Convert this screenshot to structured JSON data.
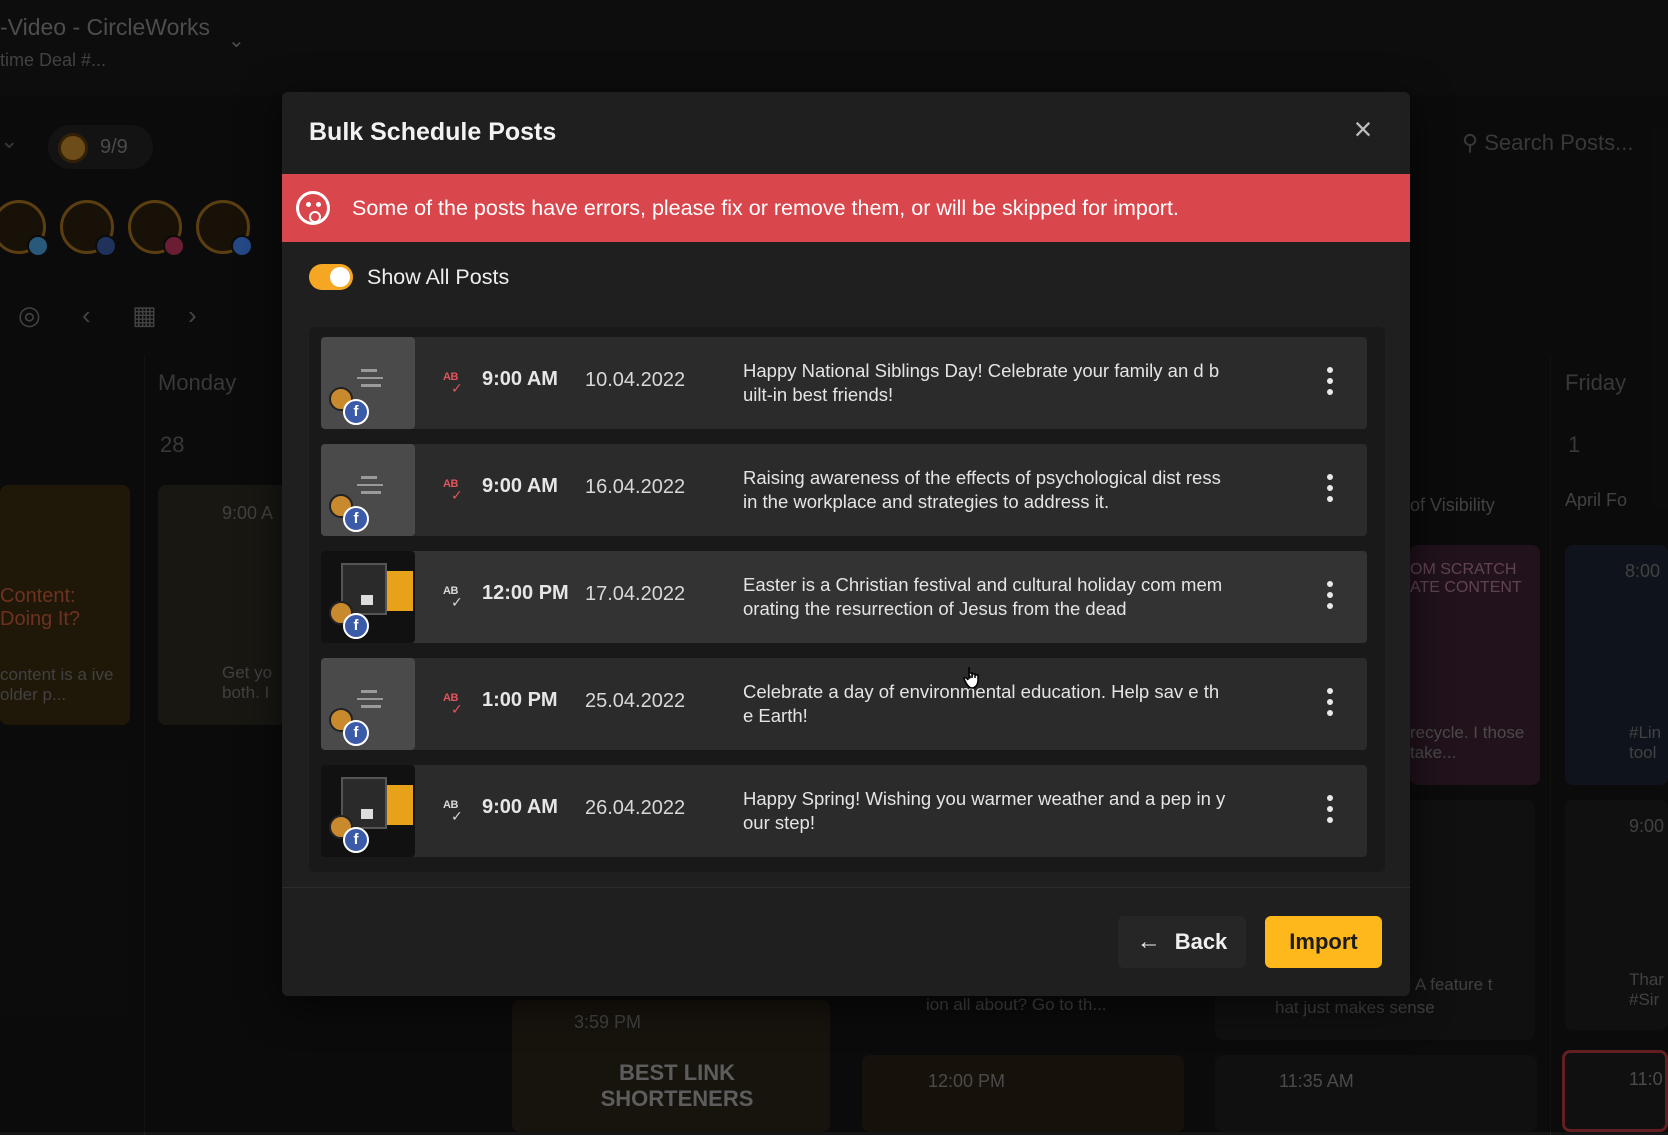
{
  "background": {
    "workspace_title": "-Video - CircleWorks",
    "workspace_subtitle": "time Deal #...",
    "account_counter": "9/9",
    "search_placeholder": "Search Posts...",
    "day_monday": "Monday",
    "day_friday": "Friday",
    "date_monday": "28",
    "date_friday": "1",
    "card_texts": [
      "Content: Doing It?",
      "content is a ive older p...",
      "9:00 A",
      "Get yo both. I",
      "of Visibility",
      "OM SCRATCH ATE CONTENT",
      "recycle. I those take...",
      "April Fo",
      "8:00",
      "#Lin tool",
      "9:00",
      "A feature t",
      "hat just makes sense",
      "ion all about? Go to th...",
      "3:59 PM",
      "BEST LINK SHORTENERS",
      "12:00 PM",
      "11:35 AM",
      "11:0",
      "Thar #Sir"
    ]
  },
  "modal": {
    "title": "Bulk Schedule Posts",
    "close_icon": "close-icon",
    "alert_text": "Some of the posts have errors, please fix or remove them, or will be skipped for import.",
    "toggle_label": "Show All Posts",
    "toggle_on": true,
    "posts": [
      {
        "time": "9:00 AM",
        "date": "10.04.2022",
        "text": "Happy National Siblings Day! Celebrate your family an d built-in best friends!",
        "status": "error",
        "media": "text"
      },
      {
        "time": "9:00 AM",
        "date": "16.04.2022",
        "text": "Raising awareness of the effects of psychological dist ress in the workplace and strategies to address it.",
        "status": "error",
        "media": "text"
      },
      {
        "time": "12:00 PM",
        "date": "17.04.2022",
        "text": "Easter is a Christian festival and cultural holiday com memorating the resurrection of Jesus from the dead",
        "status": "ok",
        "media": "image"
      },
      {
        "time": "1:00 PM",
        "date": "25.04.2022",
        "text": "Celebrate a day of environmental education. Help sav e the Earth!",
        "status": "error",
        "media": "text"
      },
      {
        "time": "9:00 AM",
        "date": "26.04.2022",
        "text": "Happy Spring! Wishing you warmer weather and a pep in your step!",
        "status": "ok",
        "media": "image"
      }
    ],
    "ab_label": "AB",
    "facebook_letter": "f",
    "back_label": "Back",
    "import_label": "Import"
  },
  "colors": {
    "alert": "#d9464c",
    "accent": "#ffb81c",
    "toggle": "#f5a623",
    "error_icon": "#e2555c"
  }
}
